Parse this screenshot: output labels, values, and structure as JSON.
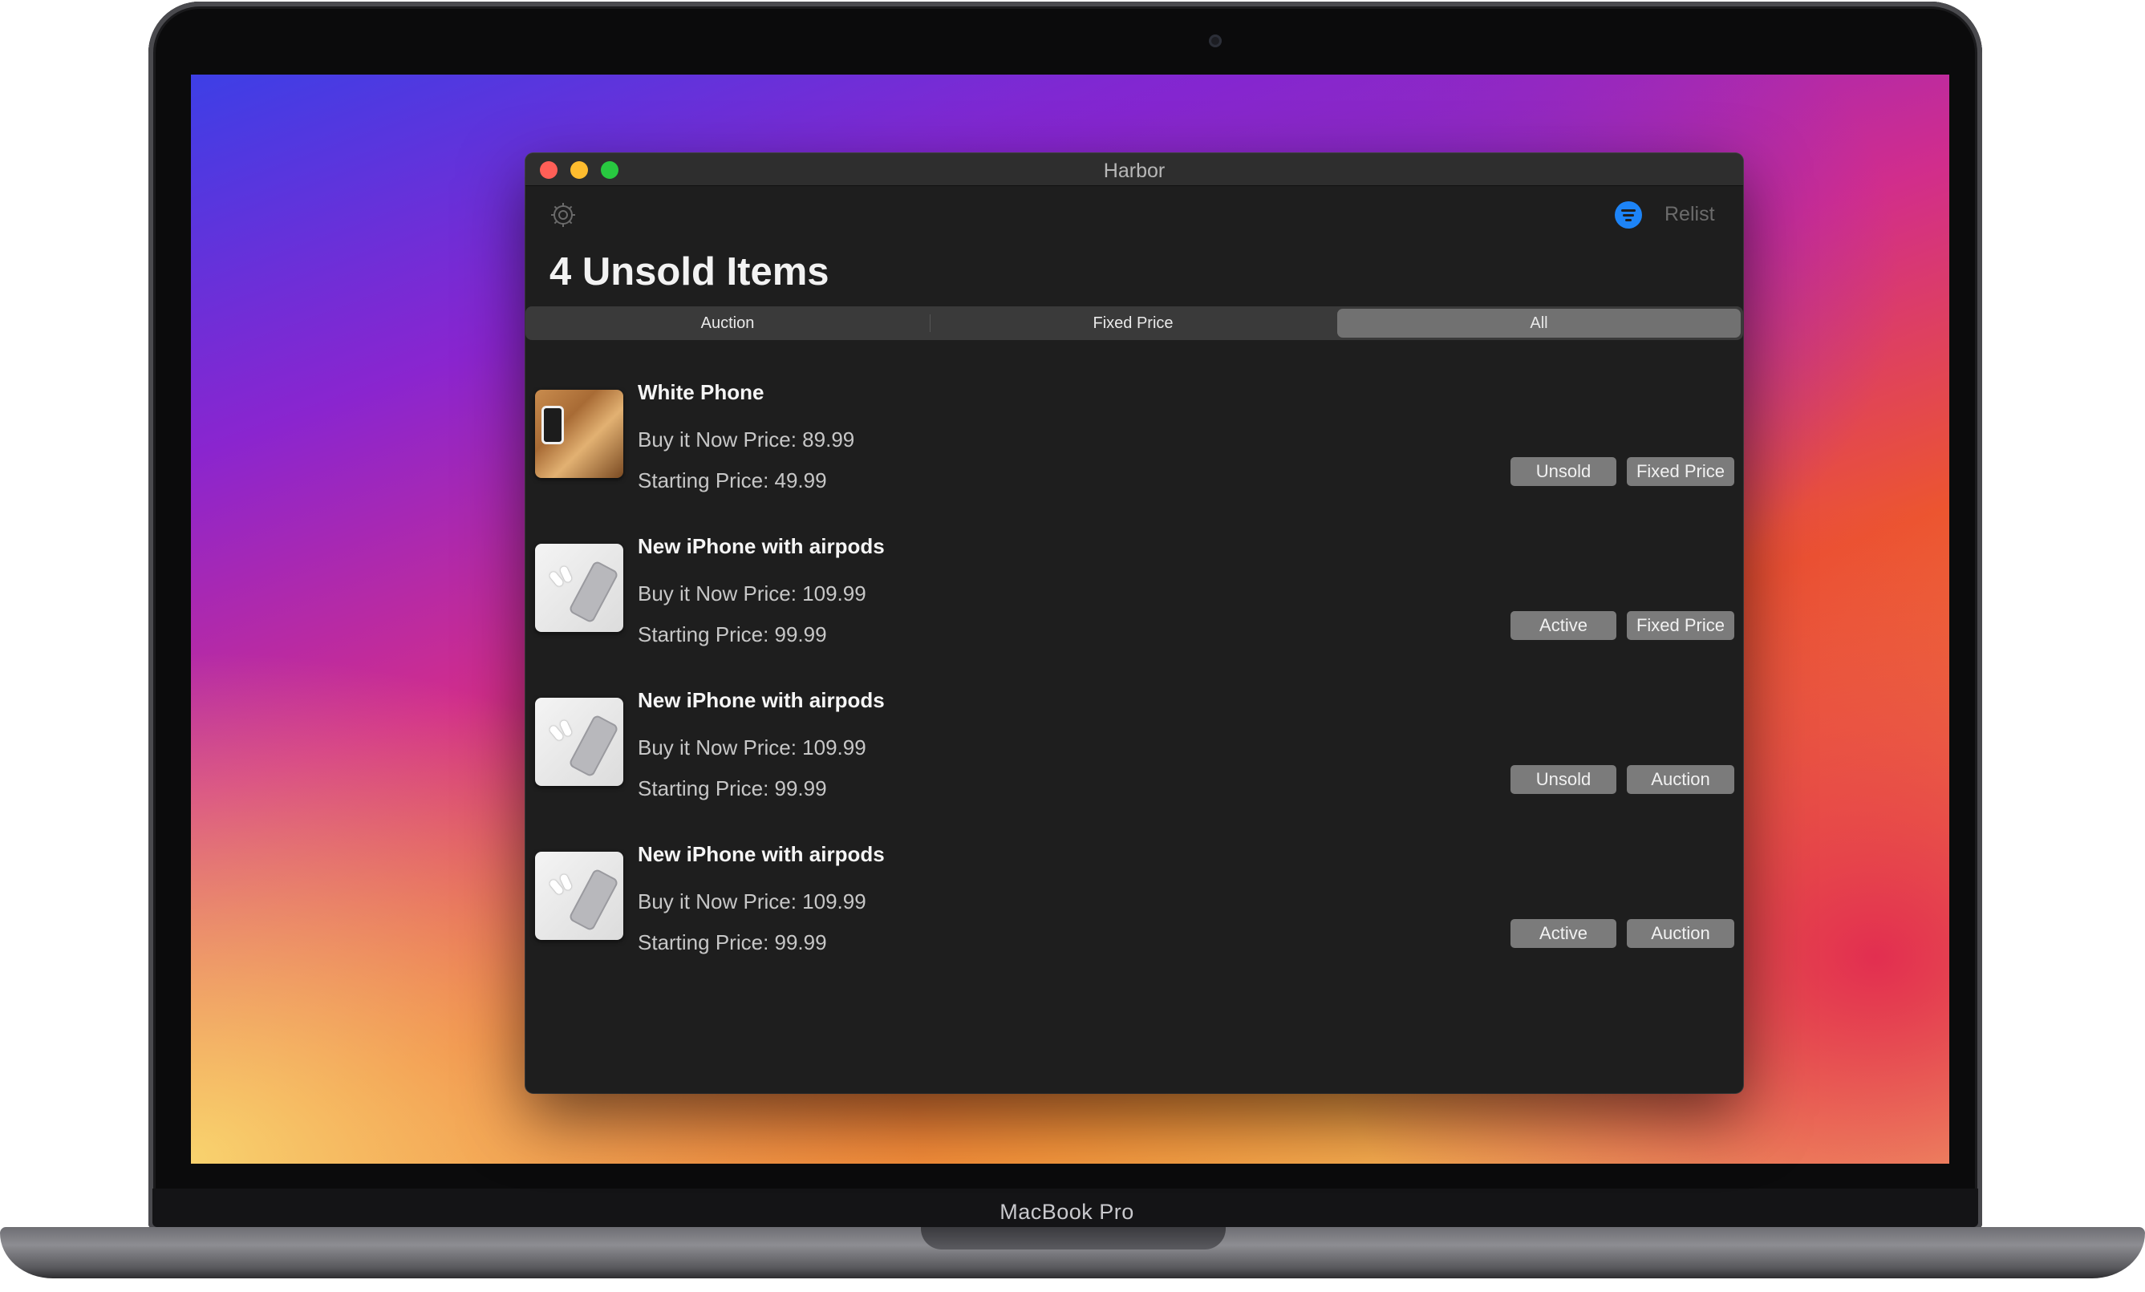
{
  "device": {
    "brand_label": "MacBook Pro"
  },
  "window": {
    "title": "Harbor"
  },
  "toolbar": {
    "settings_icon": "gear-icon",
    "filter_icon": "filter-icon",
    "relist_label": "Relist"
  },
  "page": {
    "title": "4 Unsold Items"
  },
  "segments": [
    {
      "label": "Auction",
      "selected": false
    },
    {
      "label": "Fixed Price",
      "selected": false
    },
    {
      "label": "All",
      "selected": true
    }
  ],
  "items": [
    {
      "title": "White Phone",
      "buy_it_now": "Buy it Now Price: 89.99",
      "starting": "Starting Price: 49.99",
      "status": "Unsold",
      "listing_type": "Fixed Price",
      "thumbnail": "phone-on-wood"
    },
    {
      "title": "New iPhone with airpods",
      "buy_it_now": "Buy it Now Price: 109.99",
      "starting": "Starting Price: 99.99",
      "status": "Active",
      "listing_type": "Fixed Price",
      "thumbnail": "iphone-airpods"
    },
    {
      "title": "New iPhone with airpods",
      "buy_it_now": "Buy it Now Price: 109.99",
      "starting": "Starting Price: 99.99",
      "status": "Unsold",
      "listing_type": "Auction",
      "thumbnail": "iphone-airpods"
    },
    {
      "title": "New iPhone with airpods",
      "buy_it_now": "Buy it Now Price: 109.99",
      "starting": "Starting Price: 99.99",
      "status": "Active",
      "listing_type": "Auction",
      "thumbnail": "iphone-airpods"
    }
  ],
  "colors": {
    "accent": "#1d84f7",
    "window_bg": "#1e1e1e",
    "tag_bg": "#7b7b7b"
  }
}
